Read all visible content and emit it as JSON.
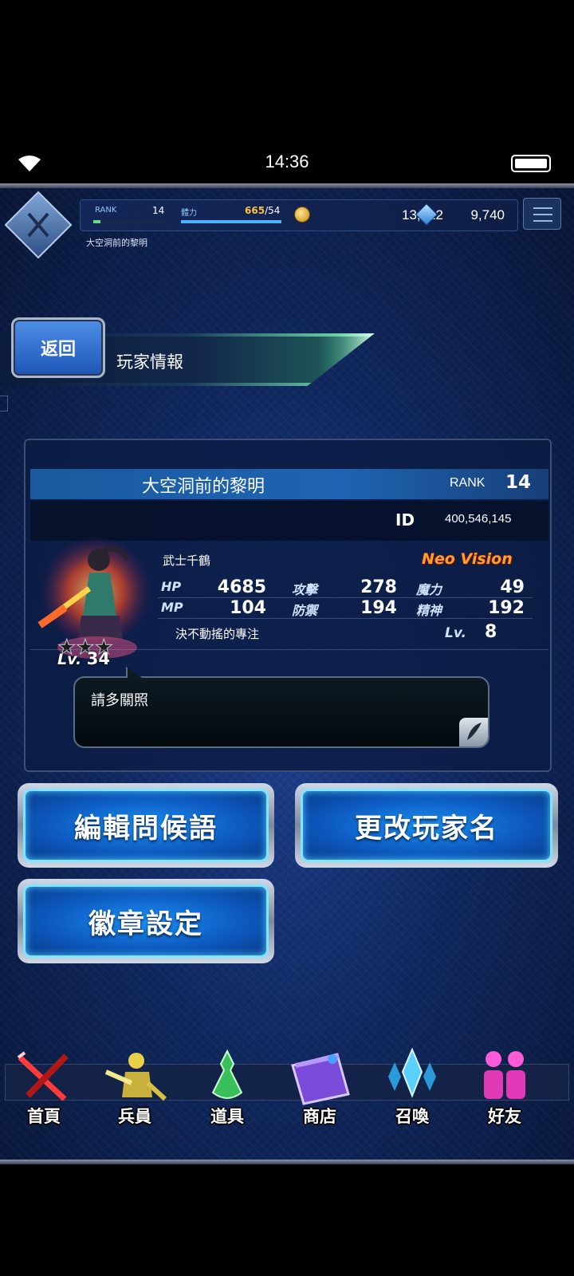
{
  "status_bar": {
    "time": "14:36"
  },
  "header": {
    "rank_label": "RANK",
    "rank_value": "14",
    "stamina_label": "體力",
    "stamina_current": "665",
    "stamina_max": "/54",
    "gil": "13,012",
    "lapis": "9,740",
    "player_name": "大空洞前的黎明"
  },
  "page": {
    "back_label": "返回",
    "title": "玩家情報"
  },
  "card": {
    "player_name": "大空洞前的黎明",
    "rank_label": "RANK",
    "rank_value": "14",
    "id_label": "ID",
    "id_value": "400,546,145",
    "unit": {
      "name": "武士千鶴",
      "tag": "Neo Vision",
      "level_label": "Lv.",
      "level": "34",
      "stats": {
        "hp_label": "HP",
        "hp": "4685",
        "atk_label": "攻擊",
        "atk": "278",
        "mag_label": "魔力",
        "mag": "49",
        "mp_label": "MP",
        "mp": "104",
        "def_label": "防禦",
        "def": "194",
        "spr_label": "精神",
        "spr": "192"
      },
      "limit_burst_name": "決不動搖的專注",
      "limit_burst_level_label": "Lv.",
      "limit_burst_level": "8"
    },
    "message": "請多關照"
  },
  "buttons": {
    "edit_greeting": "編輯問候語",
    "change_name": "更改玩家名",
    "badge_settings": "徽章設定"
  },
  "nav": {
    "items": [
      {
        "label": "首頁",
        "icon": "sword-home-icon"
      },
      {
        "label": "兵員",
        "icon": "units-icon"
      },
      {
        "label": "道具",
        "icon": "potion-icon"
      },
      {
        "label": "商店",
        "icon": "shop-icon"
      },
      {
        "label": "召喚",
        "icon": "crystal-summon-icon"
      },
      {
        "label": "好友",
        "icon": "friends-icon"
      }
    ]
  }
}
